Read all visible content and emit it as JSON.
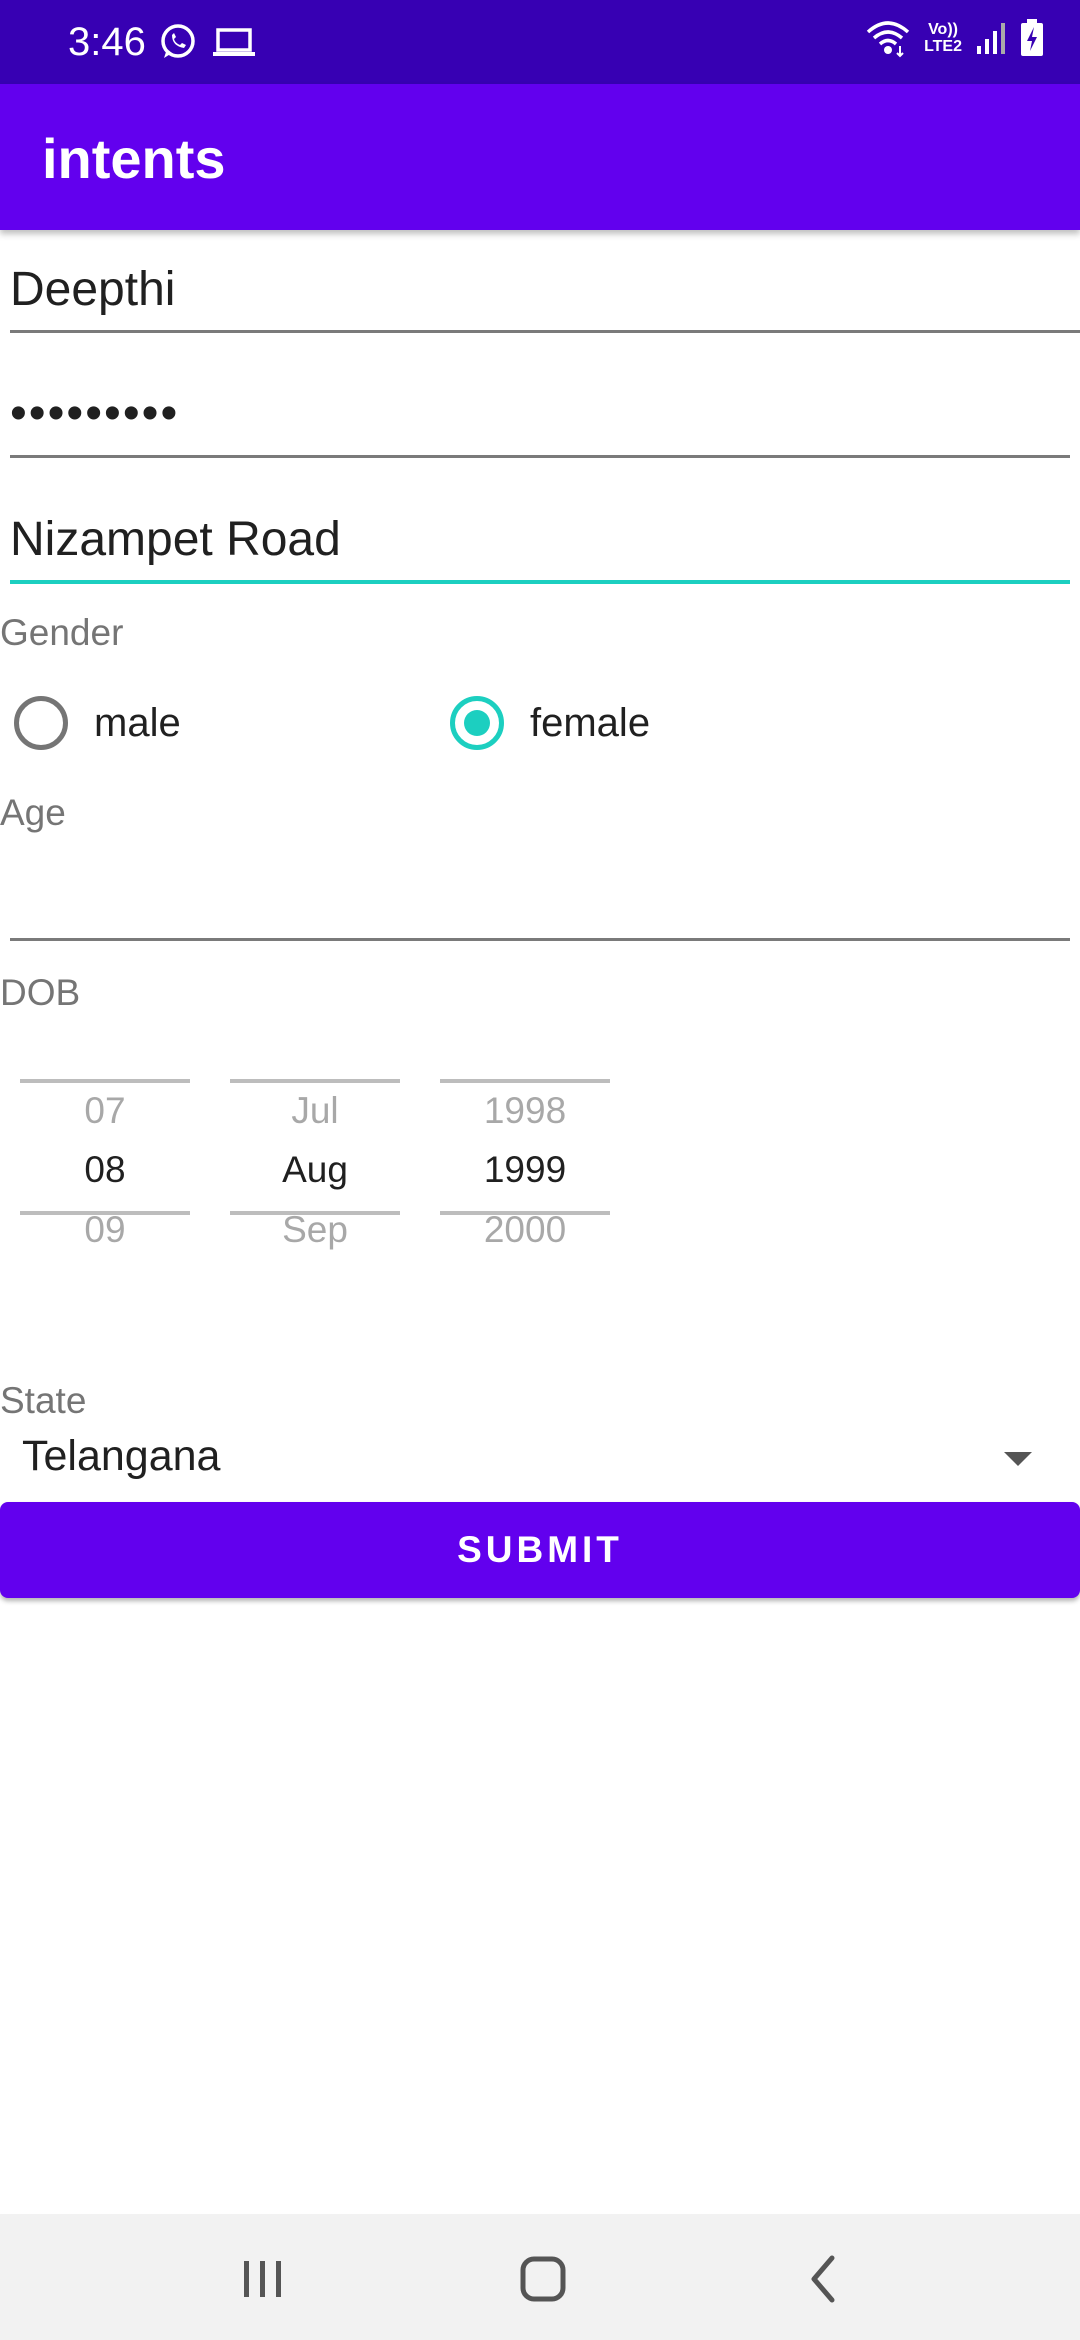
{
  "status_bar": {
    "time": "3:46",
    "network_text": "Vo))\nLTE2",
    "icons": [
      "whatsapp-icon",
      "laptop-icon",
      "wifi-icon",
      "signal-icon",
      "battery-charging-icon"
    ]
  },
  "app_bar": {
    "title": "intents"
  },
  "form": {
    "name_value": "Deepthi",
    "password_value": "•••••••••",
    "address_value": "Nizampet Road",
    "gender_label": "Gender",
    "gender_options": [
      {
        "label": "male",
        "checked": false
      },
      {
        "label": "female",
        "checked": true
      }
    ],
    "age_label": "Age",
    "age_value": "",
    "dob_label": "DOB",
    "dob_picker": {
      "day": {
        "prev": "07",
        "selected": "08",
        "next": "09"
      },
      "month": {
        "prev": "Jul",
        "selected": "Aug",
        "next": "Sep"
      },
      "year": {
        "prev": "1998",
        "selected": "1999",
        "next": "2000"
      }
    },
    "state_label": "State",
    "state_value": "Telangana",
    "submit_label": "SUBMIT"
  },
  "colors": {
    "status_bar": "#3700b3",
    "primary": "#6200ee",
    "accent": "#1ccfc0"
  },
  "nav_bar": {
    "icons": [
      "recent-apps-icon",
      "home-icon",
      "back-icon"
    ]
  }
}
